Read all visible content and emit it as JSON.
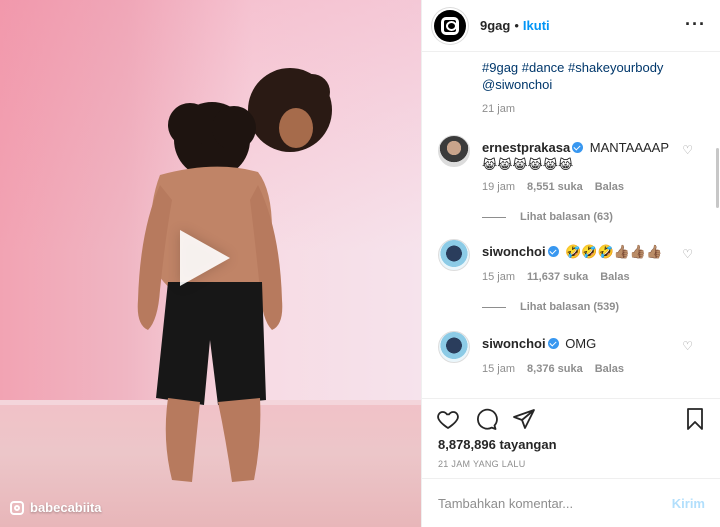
{
  "media": {
    "watermark": "babecabiita",
    "play_icon": "play-icon"
  },
  "header": {
    "username": "9gag",
    "separator": "•",
    "follow_label": "Ikuti",
    "more_icon": "more-icon"
  },
  "caption": {
    "hashtags": "#9gag #dance #shakeyourbody",
    "mention": "@siwonchoi",
    "time": "21 jam"
  },
  "comments": [
    {
      "user": "ernestprakasa",
      "text": "MANTAAAAP",
      "text_line2": "😹😹😹😹😹😹",
      "time": "19 jam",
      "likes": "8,551 suka",
      "reply": "Balas",
      "view_replies": "Lihat balasan (63)"
    },
    {
      "user": "siwonchoi",
      "text": "🤣🤣🤣👍🏽👍🏽👍🏽",
      "time": "15 jam",
      "likes": "11,637 suka",
      "reply": "Balas",
      "view_replies": "Lihat balasan (539)"
    },
    {
      "user": "siwonchoi",
      "text": "OMG",
      "time": "15 jam",
      "likes": "8,376 suka",
      "reply": "Balas"
    }
  ],
  "actions": {
    "views": "8,878,896 tayangan",
    "post_time": "21 JAM YANG LALU"
  },
  "composer": {
    "placeholder": "Tambahkan komentar...",
    "send_label": "Kirim"
  },
  "colors": {
    "link": "#00376b",
    "accent": "#0095f6",
    "muted": "#8e8e8e"
  }
}
